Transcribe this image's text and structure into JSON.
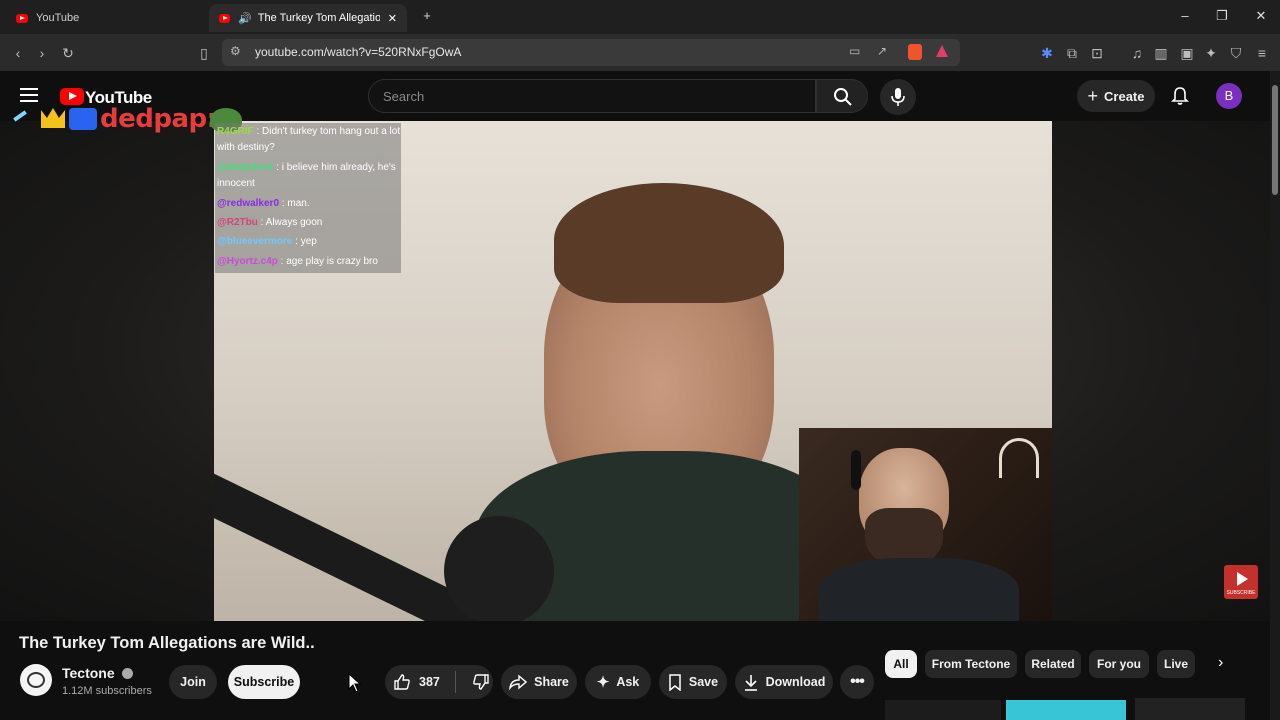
{
  "browser": {
    "tabs": [
      {
        "title": "YouTube"
      },
      {
        "title": "The Turkey Tom Allegations a"
      }
    ],
    "url": "youtube.com/watch?v=520RNxFgOwA"
  },
  "header": {
    "logo_text": "YouTube",
    "search_placeholder": "Search",
    "create_label": "Create",
    "avatar_letter": "B"
  },
  "overlay": {
    "streamer_tag": "dedpap:"
  },
  "chat": [
    {
      "user": "R4GRIF",
      "message": "Didn't turkey tom hang out a lot with destiny?",
      "color": "#9fd84a"
    },
    {
      "user": "@deejrdee1",
      "message": "i believe him already, he's innocent",
      "color": "#3fe07a"
    },
    {
      "user": "@redwalker0",
      "message": "man.",
      "color": "#8a2be2"
    },
    {
      "user": "@R2Tbu",
      "message": "Always goon",
      "color": "#d0457a"
    },
    {
      "user": "@blueevermore",
      "message": "yep",
      "color": "#6ec8ff"
    },
    {
      "user": "@Hyortz.c4p",
      "message": "age play is crazy bro",
      "color": "#c94bd9"
    }
  ],
  "video": {
    "title": "The Turkey Tom Allegations are Wild..",
    "channel": "Tectone",
    "subscribers": "1.12M subscribers",
    "join_label": "Join",
    "subscribe_label": "Subscribe",
    "likes": "387",
    "share_label": "Share",
    "ask_label": "Ask",
    "save_label": "Save",
    "download_label": "Download"
  },
  "chips": [
    "All",
    "From Tectone",
    "Related",
    "For you",
    "Live"
  ],
  "watermark": {
    "label": "SUBSCRIBE"
  }
}
